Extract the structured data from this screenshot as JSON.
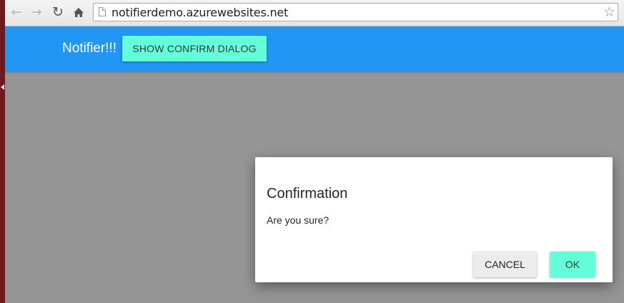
{
  "browser": {
    "url": "notifierdemo.azurewebsites.net",
    "icons": {
      "back": "arrow-left-icon",
      "forward": "arrow-right-icon",
      "reload": "reload-icon",
      "home": "home-icon",
      "page": "page-icon",
      "bookmark": "star-icon"
    }
  },
  "appbar": {
    "title": "Notifier!!!",
    "show_button_label": "SHOW CONFIRM DIALOG",
    "color": "#2196f3",
    "accent": "#64ffda"
  },
  "dialog": {
    "title": "Confirmation",
    "message": "Are you sure?",
    "cancel_label": "CANCEL",
    "ok_label": "OK"
  }
}
